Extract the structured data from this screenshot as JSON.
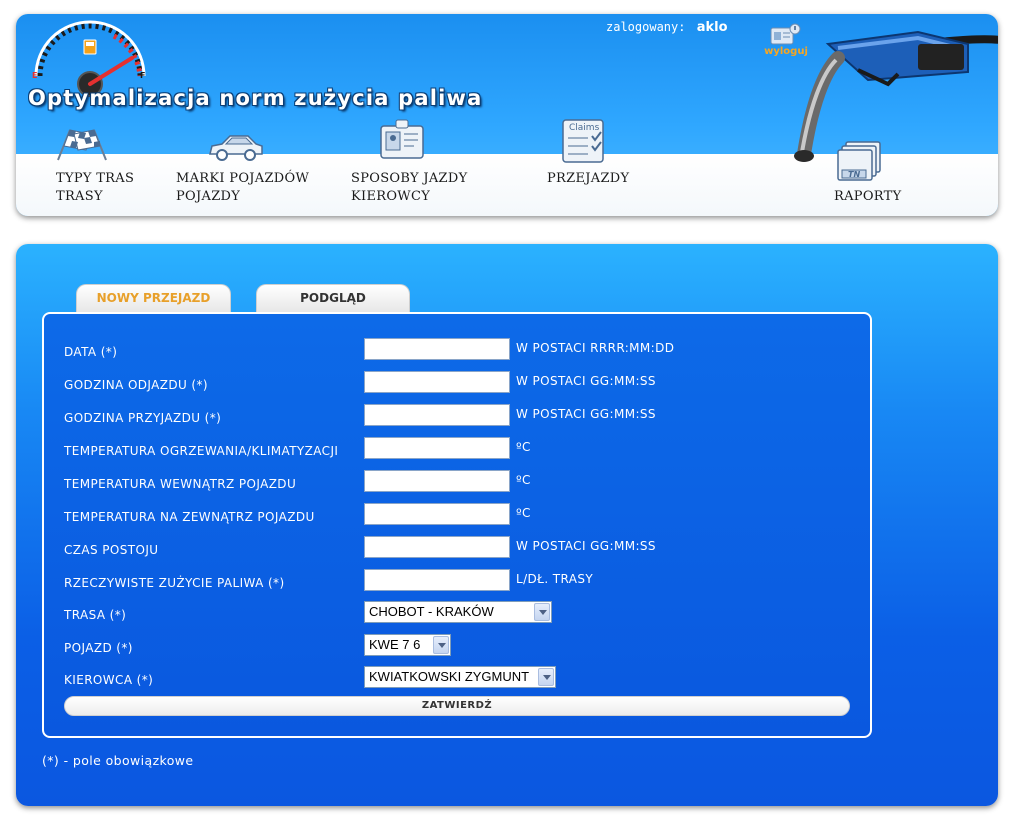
{
  "header": {
    "app_title": "Optymalizacja norm zużycia paliwa",
    "logged_in_label": "zalogowany:",
    "user": "aklo",
    "logout_label": "wyloguj",
    "nav": [
      {
        "line1": "TYPY TRAS",
        "line2": "TRASY",
        "icon": "checkered-flags-icon"
      },
      {
        "line1": "MARKI POJAZDÓW",
        "line2": "POJAZDY",
        "icon": "car-icon"
      },
      {
        "line1": "SPOSOBY JAZDY",
        "line2": "KIEROWCY",
        "icon": "id-badge-icon"
      },
      {
        "line1": "PRZEJAZDY",
        "line2": "",
        "icon": "claims-clipboard-icon"
      },
      {
        "line1": "RAPORTY",
        "line2": "",
        "icon": "report-files-icon"
      }
    ],
    "claims_text": "Claims",
    "report_icon_text": "TN"
  },
  "tabs": {
    "new": "NOWY PRZEJAZD",
    "preview": "PODGLĄD"
  },
  "form": {
    "fields": [
      {
        "label": "DATA (*)",
        "value": "",
        "hint": "W POSTACI RRRR:MM:DD"
      },
      {
        "label": "GODZINA ODJAZDU (*)",
        "value": "",
        "hint": "W POSTACI GG:MM:SS"
      },
      {
        "label": "GODZINA PRZYJAZDU (*)",
        "value": "",
        "hint": "W POSTACI GG:MM:SS"
      },
      {
        "label": "TEMPERATURA OGRZEWANIA/KLIMATYZACJI",
        "value": "",
        "hint": "ºC"
      },
      {
        "label": "TEMPERATURA WEWNĄTRZ POJAZDU",
        "value": "",
        "hint": "ºC"
      },
      {
        "label": "TEMPERATURA NA ZEWNĄTRZ POJAZDU",
        "value": "",
        "hint": "ºC"
      },
      {
        "label": "CZAS POSTOJU",
        "value": "",
        "hint": "W POSTACI GG:MM:SS"
      },
      {
        "label": "RZECZYWISTE ZUŻYCIE PALIWA (*)",
        "value": "",
        "hint": "L/DŁ. TRASY"
      }
    ],
    "selects": [
      {
        "label": "TRASA (*)",
        "selected": "CHOBOT - KRAKÓW"
      },
      {
        "label": "POJAZD (*)",
        "selected": "KWE 7 6"
      },
      {
        "label": "KIEROWCA (*)",
        "selected": "KWIATKOWSKI ZYGMUNT"
      }
    ],
    "submit_label": "ZATWIERDŹ"
  },
  "required_note": "(*) - pole obowiązkowe",
  "colors": {
    "accent_orange": "#e8a02a",
    "header_blue": "#2fa7ff",
    "panel_blue": "#0b5fe6"
  }
}
